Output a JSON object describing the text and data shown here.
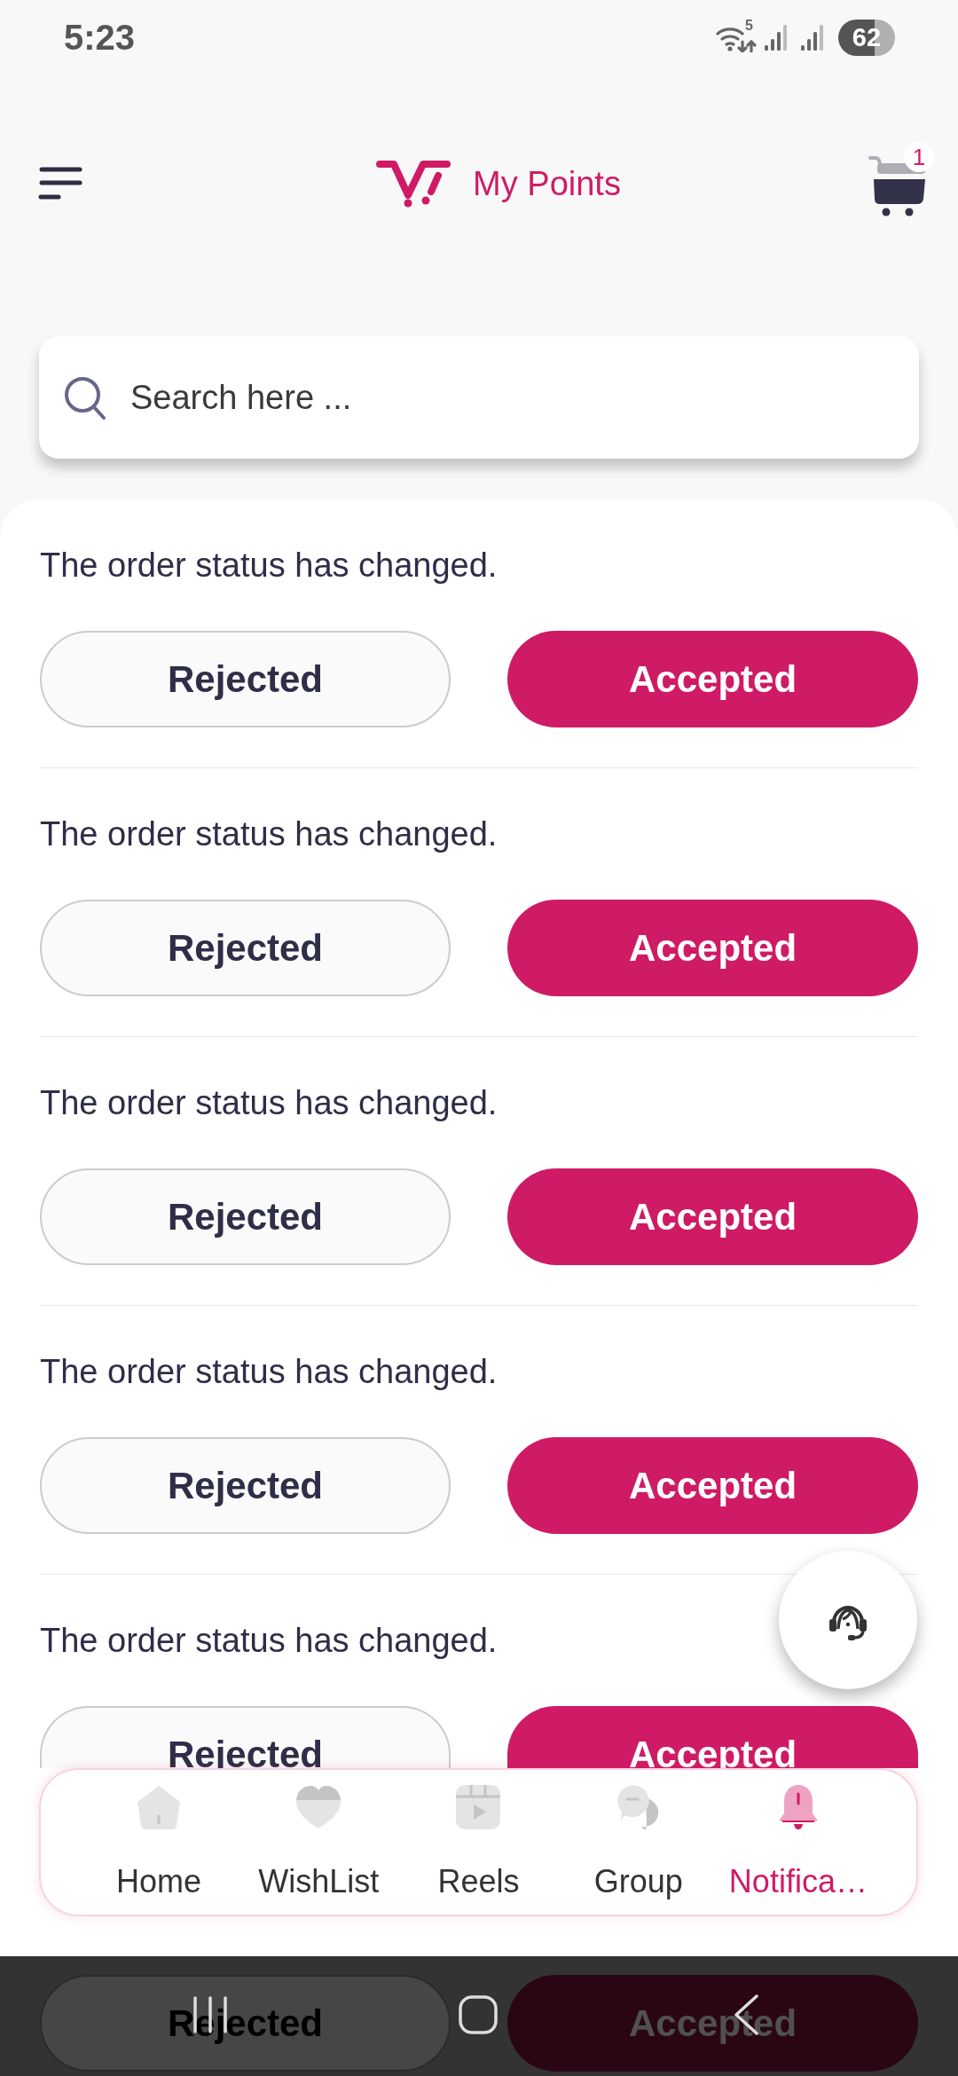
{
  "status_bar": {
    "time": "5:23",
    "wifi_label": "5",
    "battery": "62"
  },
  "header": {
    "title": "My Points",
    "cart_count": "1"
  },
  "search": {
    "placeholder": "Search here ..."
  },
  "notifications": [
    {
      "message": "The order status has changed.",
      "actions": [
        {
          "label": "Rejected",
          "kind": "outline"
        },
        {
          "label": "Accepted",
          "kind": "filled"
        }
      ]
    },
    {
      "message": "The order status has changed.",
      "actions": [
        {
          "label": "Rejected",
          "kind": "outline"
        },
        {
          "label": "Accepted",
          "kind": "filled"
        }
      ]
    },
    {
      "message": "The order status has changed.",
      "actions": [
        {
          "label": "Rejected",
          "kind": "outline"
        },
        {
          "label": "Accepted",
          "kind": "filled"
        }
      ]
    },
    {
      "message": "The order status has changed.",
      "actions": [
        {
          "label": "Rejected",
          "kind": "outline"
        },
        {
          "label": "Accepted",
          "kind": "filled"
        }
      ]
    },
    {
      "message": "The order status has changed.",
      "actions": [
        {
          "label": "Rejected",
          "kind": "outline"
        },
        {
          "label": "Accepted",
          "kind": "filled"
        }
      ]
    },
    {
      "actions": [
        {
          "label": "Rejected",
          "kind": "outline"
        },
        {
          "label": "Accepted",
          "kind": "filled"
        }
      ]
    }
  ],
  "bottom_nav": {
    "items": [
      {
        "label": "Home",
        "selected": false
      },
      {
        "label": "WishList",
        "selected": false
      },
      {
        "label": "Reels",
        "selected": false
      },
      {
        "label": "Group",
        "selected": false
      },
      {
        "label": "Notifica…",
        "selected": true
      }
    ]
  }
}
